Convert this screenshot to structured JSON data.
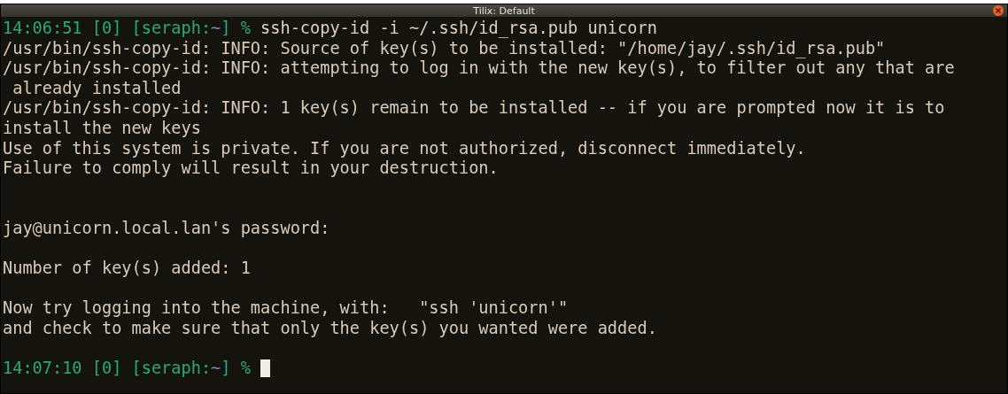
{
  "window": {
    "title": "Tilix: Default"
  },
  "terminal": {
    "lines": [
      {
        "kind": "prompt",
        "prompt": "14:06:51 [0] [seraph:",
        "cwd": "~",
        "prompt_end": "] %",
        "command": "ssh-copy-id -i ~/.ssh/id_rsa.pub unicorn",
        "cursor": false
      },
      {
        "kind": "output",
        "text": "/usr/bin/ssh-copy-id: INFO: Source of key(s) to be installed: \"/home/jay/.ssh/id_rsa.pub\""
      },
      {
        "kind": "output",
        "text": "/usr/bin/ssh-copy-id: INFO: attempting to log in with the new key(s), to filter out any that are"
      },
      {
        "kind": "output",
        "text": " already installed"
      },
      {
        "kind": "output",
        "text": "/usr/bin/ssh-copy-id: INFO: 1 key(s) remain to be installed -- if you are prompted now it is to"
      },
      {
        "kind": "output",
        "text": "install the new keys"
      },
      {
        "kind": "output",
        "text": "Use of this system is private. If you are not authorized, disconnect immediately."
      },
      {
        "kind": "output",
        "text": "Failure to comply will result in your destruction."
      },
      {
        "kind": "blank"
      },
      {
        "kind": "blank"
      },
      {
        "kind": "output",
        "text": "jay@unicorn.local.lan's password:"
      },
      {
        "kind": "blank"
      },
      {
        "kind": "output",
        "text": "Number of key(s) added: 1"
      },
      {
        "kind": "blank"
      },
      {
        "kind": "output",
        "text": "Now try logging into the machine, with:   \"ssh 'unicorn'\""
      },
      {
        "kind": "output",
        "text": "and check to make sure that only the key(s) you wanted were added."
      },
      {
        "kind": "blank"
      },
      {
        "kind": "prompt",
        "prompt": "14:07:10 [0] [seraph:",
        "cwd": "~",
        "prompt_end": "] %",
        "cursor": true
      }
    ]
  }
}
